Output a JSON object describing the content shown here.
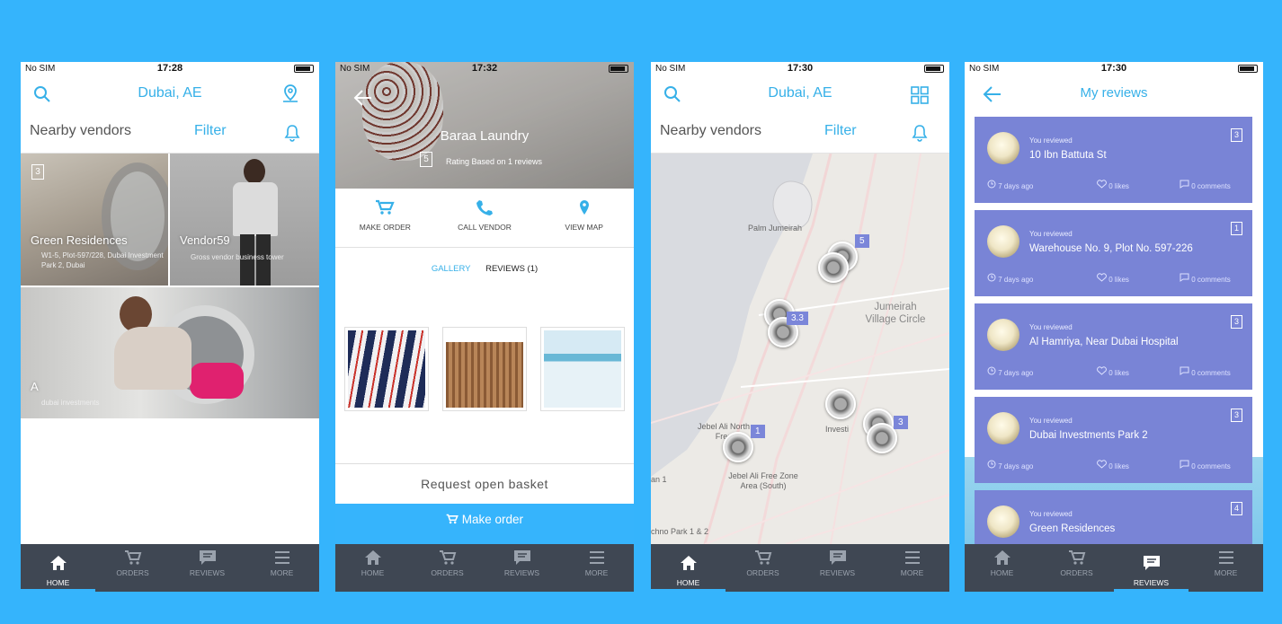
{
  "status": {
    "carrier": "No SIM",
    "t1": "17:28",
    "t2": "17:32",
    "t3": "17:30",
    "t4": "17:30"
  },
  "home": {
    "location": "Dubai, AE",
    "nearby": "Nearby vendors",
    "filter": "Filter",
    "vendors": [
      {
        "name": "Green Residences",
        "address": "W1-5, Plot-597/228, Dubai Investment Park 2, Dubai",
        "badge": "3"
      },
      {
        "name": "Vendor59",
        "address": "Gross vendor business tower"
      },
      {
        "name": "A",
        "address": "dubai investments"
      }
    ]
  },
  "vendor": {
    "name": "Baraa Laundry",
    "rating": "5",
    "rating_text": "Rating Based on 1 reviews",
    "make_order": "MAKE ORDER",
    "call_vendor": "CALL VENDOR",
    "view_map": "VIEW MAP",
    "gallery": "GALLERY",
    "reviews": "REVIEWS (1)",
    "request": "Request open basket",
    "order_btn": "Make order"
  },
  "map": {
    "location": "Dubai, AE",
    "nearby": "Nearby vendors",
    "filter": "Filter",
    "labels": [
      "Palm Jumeirah",
      "Jumeirah Village Circle",
      "Jebel Ali North Free",
      "Jebel Ali Free Zone Area (South)",
      "Investi",
      "chno Park 1 & 2",
      "an 1"
    ],
    "clusters": [
      "5",
      "3.3",
      "1",
      "3"
    ]
  },
  "reviews": {
    "title": "My reviews",
    "you_reviewed": "You reviewed",
    "items": [
      {
        "place": "10 Ibn Battuta St",
        "ago": "7 days ago",
        "likes": "0 likes",
        "comments": "0 comments",
        "badge": "3"
      },
      {
        "place": "Warehouse No. 9, Plot No. 597-226",
        "ago": "7 days ago",
        "likes": "0 likes",
        "comments": "0 comments",
        "badge": "1"
      },
      {
        "place": "Al Hamriya, Near Dubai Hospital",
        "ago": "7 days ago",
        "likes": "0 likes",
        "comments": "0 comments",
        "badge": "3"
      },
      {
        "place": "Dubai Investments Park 2",
        "ago": "7 days ago",
        "likes": "0 likes",
        "comments": "0 comments",
        "badge": "3"
      },
      {
        "place": "Green Residences",
        "badge": "4"
      }
    ]
  },
  "tabs": {
    "home": "HOME",
    "orders": "ORDERS",
    "reviews": "REVIEWS",
    "more": "MORE"
  },
  "colors": {
    "bg": "#35b4fc",
    "accent": "#36b0e8",
    "card": "#7984d6",
    "tabbar": "#3f4753"
  }
}
